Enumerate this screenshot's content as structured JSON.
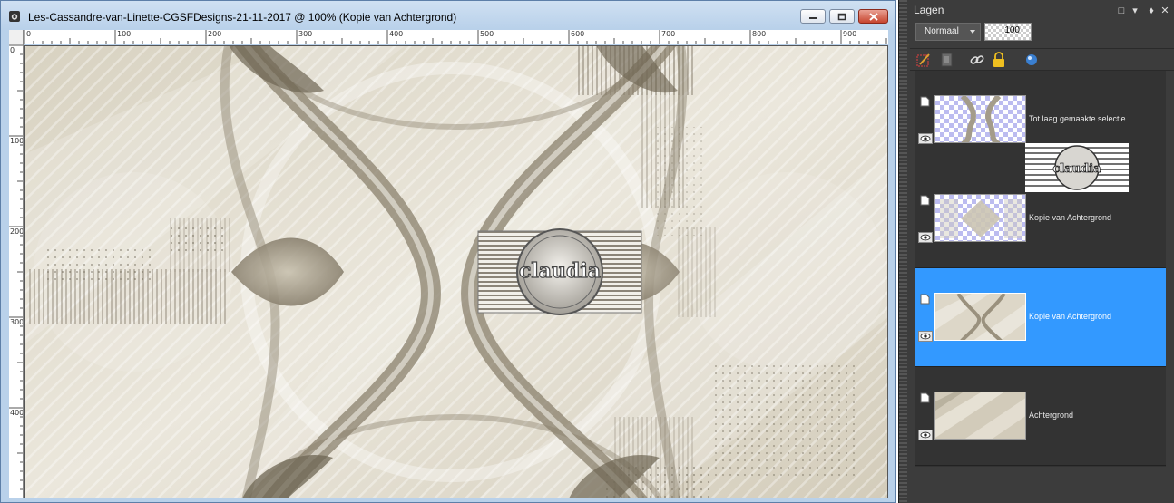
{
  "document": {
    "title": "Les-Cassandre-van-Linette-CGSFDesigns-21-11-2017 @ 100% (Kopie van Achtergrond)",
    "ruler_top_labels": [
      "0",
      "100",
      "200",
      "300",
      "400",
      "500",
      "600",
      "700",
      "800",
      "900"
    ],
    "ruler_left_labels": [
      "0",
      "100",
      "200",
      "300",
      "400"
    ],
    "watermark_text": "claudia"
  },
  "layers_panel": {
    "title": "Lagen",
    "blend_mode": "Normaal",
    "opacity": "100",
    "selected_color": "#3399ff",
    "layers": [
      {
        "name": "Tot laag gemaakte selectie",
        "selected": false,
        "visible": true
      },
      {
        "name": "Kopie van Achtergrond",
        "selected": false,
        "visible": true
      },
      {
        "name": "Kopie van Achtergrond",
        "selected": true,
        "visible": true
      },
      {
        "name": "Achtergrond",
        "selected": false,
        "visible": true
      }
    ]
  }
}
